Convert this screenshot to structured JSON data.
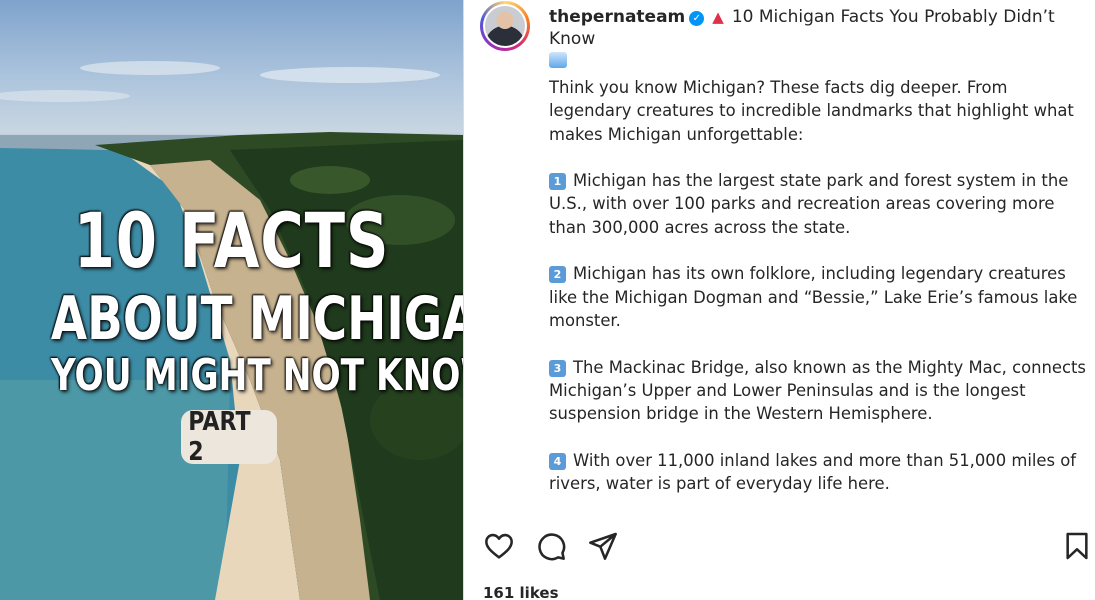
{
  "media": {
    "title_line1": "10 FACTS",
    "title_line2": "ABOUT MICHIGAN",
    "title_line3": "YOU MIGHT NOT KNOW",
    "badge": "PART 2"
  },
  "post": {
    "username": "thepernateam",
    "title": "10 Michigan Facts You Probably Didn’t Know",
    "intro": "Think you know Michigan? These facts dig deeper. From legendary creatures to incredible landmarks that highlight what makes Michigan unforgettable:",
    "facts": [
      {
        "num": "1",
        "text": "Michigan has the largest state park and forest system in the U.S., with over 100 parks and recreation areas covering more than 300,000 acres across the state."
      },
      {
        "num": "2",
        "text": "Michigan has its own folklore, including legendary creatures like the Michigan Dogman and “Bessie,” Lake Erie’s famous lake monster."
      },
      {
        "num": "3",
        "text": "The Mackinac Bridge, also known as the Mighty Mac, connects Michigan’s Upper and Lower Peninsulas and is the longest suspension bridge in the Western Hemisphere."
      },
      {
        "num": "4",
        "text": "With over 11,000 inland lakes and more than 51,000 miles of rivers, water is part of everyday life here."
      }
    ],
    "likes": "161 likes"
  },
  "icons": {
    "verified": "verified-badge-icon",
    "title_emoji": "dress-icon",
    "trailing_emoji": "wave-icon",
    "like": "heart-icon",
    "comment": "comment-icon",
    "share": "share-icon",
    "save": "bookmark-icon"
  },
  "colors": {
    "verified": "#0095f6",
    "number_key": "#5b9bd8",
    "text": "#262626"
  }
}
